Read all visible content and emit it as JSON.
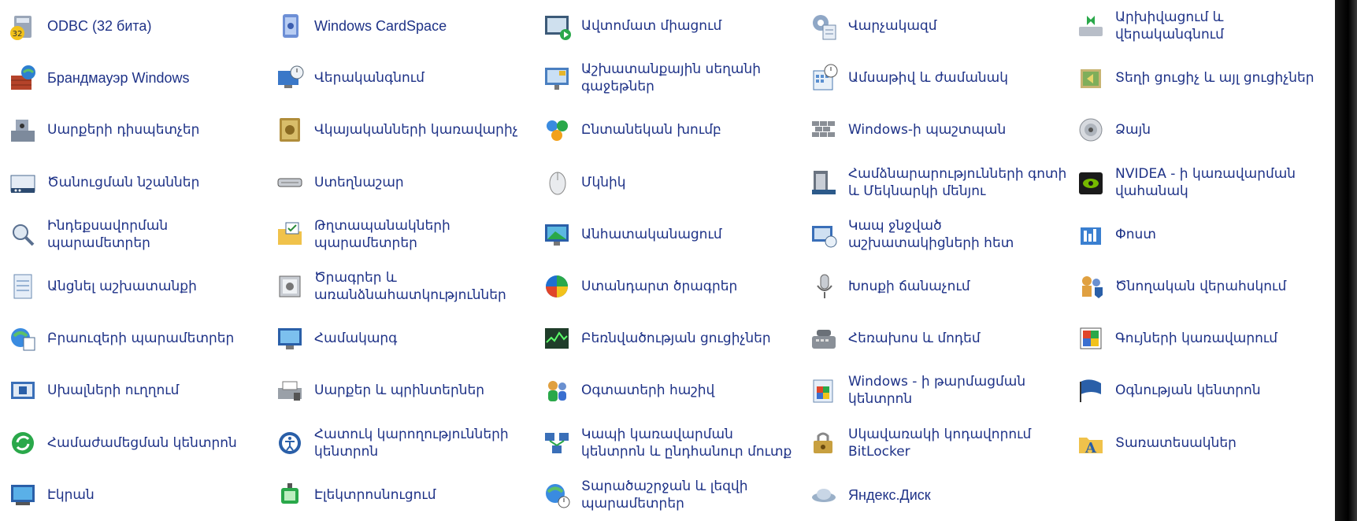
{
  "control_panel": {
    "items": [
      {
        "label": "ODBC (32 бита)",
        "icon": "odbc-icon"
      },
      {
        "label": "Windows CardSpace",
        "icon": "cardspace-icon"
      },
      {
        "label": "Ավտոմատ միացում",
        "icon": "autoplay-icon"
      },
      {
        "label": "Վարչակազմ",
        "icon": "admin-tools-icon"
      },
      {
        "label": "Արխիվացում և վերականգնում",
        "icon": "backup-restore-icon"
      },
      {
        "label": "Брандмауэр Windows",
        "icon": "firewall-icon"
      },
      {
        "label": "Վերականգնում",
        "icon": "recovery-icon"
      },
      {
        "label": "Աշխատանքային սեղանի գաջեթներ",
        "icon": "desktop-gadgets-icon"
      },
      {
        "label": "Ամսաթիվ և ժամանակ",
        "icon": "date-time-icon"
      },
      {
        "label": "Տեղի ցուցիչ և այլ ցուցիչներ",
        "icon": "location-sensors-icon"
      },
      {
        "label": "Սարքերի դիսպետչեր",
        "icon": "device-manager-icon"
      },
      {
        "label": "Վկայականների կառավարիչ",
        "icon": "credential-manager-icon"
      },
      {
        "label": "Ընտանեկան խումբ",
        "icon": "homegroup-icon"
      },
      {
        "label": "Windows-ի պաշտպան",
        "icon": "defender-icon"
      },
      {
        "label": "Ձայն",
        "icon": "sound-icon"
      },
      {
        "label": "Ծանուցման նշաններ",
        "icon": "notification-icons-icon"
      },
      {
        "label": "Ստեղնաշար",
        "icon": "keyboard-icon"
      },
      {
        "label": "Մկնիկ",
        "icon": "mouse-icon"
      },
      {
        "label": "Համձնարարությունների գոտի և Մեկնարկի մենյու",
        "icon": "taskbar-start-icon"
      },
      {
        "label": "NVIDEA - ի կառավարման վահանակ",
        "icon": "nvidia-icon"
      },
      {
        "label": "Ինդեքսավորման պարամետրեր",
        "icon": "indexing-icon"
      },
      {
        "label": "Թղտապանակների պարամետրեր",
        "icon": "folder-options-icon"
      },
      {
        "label": "Անհատականացում",
        "icon": "personalization-icon"
      },
      {
        "label": "Կապ ջնջված աշխատակիցների հետ",
        "icon": "remoteapp-icon"
      },
      {
        "label": "Փոստ",
        "icon": "mail-icon"
      },
      {
        "label": "Անցնել աշխատանքի",
        "icon": "work-folders-icon"
      },
      {
        "label": "Ծրագրեր և առանձնահատկություններ",
        "icon": "programs-features-icon"
      },
      {
        "label": "Ստանդարտ ծրագրեր",
        "icon": "default-programs-icon"
      },
      {
        "label": "Խոսքի ճանաչում",
        "icon": "speech-recognition-icon"
      },
      {
        "label": "Ծնողական վերահսկում",
        "icon": "parental-controls-icon"
      },
      {
        "label": "Բրաուզերի պարամետրեր",
        "icon": "internet-options-icon"
      },
      {
        "label": "Համակարգ",
        "icon": "system-icon"
      },
      {
        "label": "Բեռնվածության ցուցիչներ",
        "icon": "performance-icon"
      },
      {
        "label": "Հեռախոս և մոդեմ",
        "icon": "phone-modem-icon"
      },
      {
        "label": "Գույների կառավարում",
        "icon": "color-management-icon"
      },
      {
        "label": "Սխալների ուղղում",
        "icon": "troubleshooting-icon"
      },
      {
        "label": "Սարքեր և պրինտերներ",
        "icon": "devices-printers-icon"
      },
      {
        "label": "Օգտատերի հաշիվ",
        "icon": "user-accounts-icon"
      },
      {
        "label": "Windows - ի թարմացման կենտրոն",
        "icon": "windows-update-icon"
      },
      {
        "label": "Օգնության կենտրոն",
        "icon": "action-center-icon"
      },
      {
        "label": "Համաժամեցման կենտրոն",
        "icon": "sync-center-icon"
      },
      {
        "label": "Հատուկ կարողությունների կենտրոն",
        "icon": "ease-of-access-icon"
      },
      {
        "label": "Կապի կառավարման կենտրոն և ընդհանուր մուտք",
        "icon": "network-sharing-icon"
      },
      {
        "label": "Սկավառակի կոդավորում BitLocker",
        "icon": "bitlocker-icon"
      },
      {
        "label": "Տառատեսակներ",
        "icon": "fonts-icon"
      },
      {
        "label": "Էկրան",
        "icon": "display-icon"
      },
      {
        "label": "Էլեկտրոսնուցում",
        "icon": "power-options-icon"
      },
      {
        "label": "Տարածաշրջան և լեզվի պարամետրեր",
        "icon": "region-language-icon"
      },
      {
        "label": "Яндекс.Диск",
        "icon": "yandex-disk-icon"
      },
      {
        "label": "",
        "icon": ""
      }
    ]
  },
  "colors": {
    "link": "#1e3287",
    "background": "#ffffff"
  }
}
